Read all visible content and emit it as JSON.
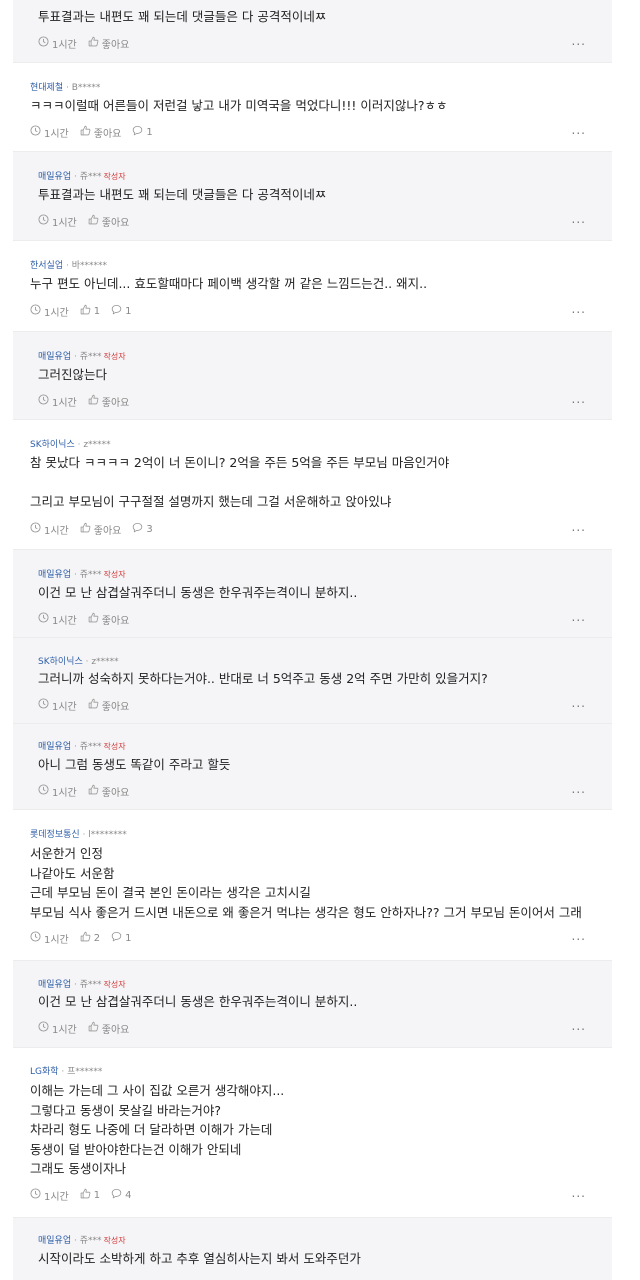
{
  "comments": [
    {
      "type": "reply",
      "company": "",
      "nick": "",
      "badge": "",
      "lines": [
        "투표결과는 내편도 꽤 되는데 댓글들은 다 공격적이네ㅉ"
      ],
      "time": "1시간",
      "like": "좋아요",
      "reply_count": "",
      "more": "..."
    },
    {
      "type": "top",
      "company": "현대제철",
      "nick": "B*****",
      "badge": "",
      "lines": [
        "ㅋㅋㅋ이럴때 어른들이 저런걸 낳고 내가 미역국을 먹었다니!!! 이러지않나?ㅎㅎ"
      ],
      "time": "1시간",
      "like": "좋아요",
      "reply_count": "1",
      "more": "..."
    },
    {
      "type": "reply",
      "company": "매일유업",
      "nick": "쥬***",
      "badge": "작성자",
      "lines": [
        "투표결과는 내편도 꽤 되는데 댓글들은 다 공격적이네ㅉ"
      ],
      "time": "1시간",
      "like": "좋아요",
      "reply_count": "",
      "more": "..."
    },
    {
      "type": "top",
      "company": "한서실업",
      "nick": "바******",
      "badge": "",
      "lines": [
        "누구 편도 아닌데... 효도할때마다 페이백 생각할 꺼 같은 느낌드는건.. 왜지.."
      ],
      "time": "1시간",
      "like": "1",
      "reply_count": "1",
      "more": "..."
    },
    {
      "type": "reply",
      "company": "매일유업",
      "nick": "쥬***",
      "badge": "작성자",
      "lines": [
        "그러진않는다"
      ],
      "time": "1시간",
      "like": "좋아요",
      "reply_count": "",
      "more": "..."
    },
    {
      "type": "top",
      "company": "SK하이닉스",
      "nick": "z*****",
      "badge": "",
      "lines": [
        "참 못났다 ㅋㅋㅋㅋ 2억이 너 돈이니? 2억을 주든 5억을 주든 부모님 마음인거야",
        "",
        "그리고 부모님이 구구절절 설명까지 했는데 그걸 서운해하고 앉아있냐"
      ],
      "time": "1시간",
      "like": "좋아요",
      "reply_count": "3",
      "more": "..."
    },
    {
      "type": "reply",
      "company": "매일유업",
      "nick": "쥬***",
      "badge": "작성자",
      "lines": [
        "이건 모 난 삼겹살궈주더니 동생은 한우궈주는격이니 분하지.."
      ],
      "time": "1시간",
      "like": "좋아요",
      "reply_count": "",
      "more": "..."
    },
    {
      "type": "reply",
      "company": "SK하이닉스",
      "nick": "z*****",
      "badge": "",
      "lines": [
        "그러니까 성숙하지 못하다는거야.. 반대로 너 5억주고 동생 2억 주면 가만히 있을거지?"
      ],
      "time": "1시간",
      "like": "좋아요",
      "reply_count": "",
      "more": "..."
    },
    {
      "type": "reply",
      "company": "매일유업",
      "nick": "쥬***",
      "badge": "작성자",
      "lines": [
        "아니 그럼 동생도 똑같이 주라고 할듯"
      ],
      "time": "1시간",
      "like": "좋아요",
      "reply_count": "",
      "more": "..."
    },
    {
      "type": "top",
      "company": "롯데정보통신",
      "nick": "l********",
      "badge": "",
      "lines": [
        "서운한거 인정",
        "나같아도 서운함",
        "근데 부모님 돈이 결국 본인 돈이라는 생각은 고치시길",
        "부모님 식사 좋은거 드시면 내돈으로 왜 좋은거 먹냐는 생각은 형도 안하자나?? 그거 부모님 돈이어서 그래"
      ],
      "time": "1시간",
      "like": "2",
      "reply_count": "1",
      "more": "..."
    },
    {
      "type": "reply",
      "company": "매일유업",
      "nick": "쥬***",
      "badge": "작성자",
      "lines": [
        "이건 모 난 삼겹살궈주더니 동생은 한우궈주는격이니 분하지.."
      ],
      "time": "1시간",
      "like": "좋아요",
      "reply_count": "",
      "more": "..."
    },
    {
      "type": "top",
      "company": "LG화학",
      "nick": "프******",
      "badge": "",
      "lines": [
        "이해는 가는데 그 사이 집값 오른거 생각해야지...",
        "그렇다고 동생이 못살길 바라는거야?",
        "차라리 형도 나중에 더 달라하면 이해가 가는데",
        "동생이 덜 받아야한다는건 이해가 안되네",
        "그래도 동생이자나"
      ],
      "time": "1시간",
      "like": "1",
      "reply_count": "4",
      "more": "..."
    },
    {
      "type": "reply",
      "company": "매일유업",
      "nick": "쥬***",
      "badge": "작성자",
      "lines": [
        "시작이라도 소박하게 하고 추후 열심히사는지 봐서 도와주던가"
      ],
      "time": "",
      "like": "",
      "reply_count": "",
      "more": ""
    }
  ]
}
